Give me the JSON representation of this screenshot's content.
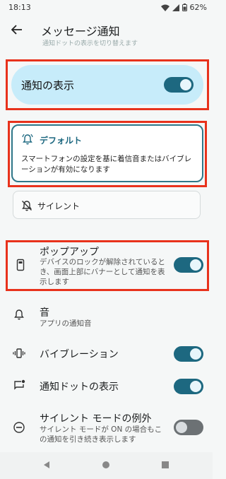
{
  "status_bar": {
    "time": "18:13",
    "battery": "62%"
  },
  "header": {
    "title": "メッセージ通知"
  },
  "faded_text": "通知ドットの表示を切り替えます",
  "show_notifications": {
    "label": "通知の表示",
    "enabled": true
  },
  "default_option": {
    "title": "デフォルト",
    "description": "スマートフォンの設定を基に着信音またはバイブレーションが有効になります"
  },
  "silent_option": {
    "title": "サイレント"
  },
  "popup": {
    "title": "ポップアップ",
    "description": "デバイスのロックが解除されているとき、画面上部にバナーとして通知を表示します",
    "enabled": true
  },
  "sound": {
    "title": "音",
    "subtitle": "アプリの通知音"
  },
  "vibration": {
    "title": "バイブレーション",
    "enabled": true
  },
  "notification_dot": {
    "title": "通知ドットの表示",
    "enabled": true
  },
  "dnd_override": {
    "title": "サイレント モードの例外",
    "description": "サイレント モードが ON の場合もこの通知を引き続き表示します",
    "enabled": false
  },
  "colors": {
    "accent": "#1d6880",
    "highlight_box": "#e8321c",
    "card_bg": "#c7ecfa"
  }
}
